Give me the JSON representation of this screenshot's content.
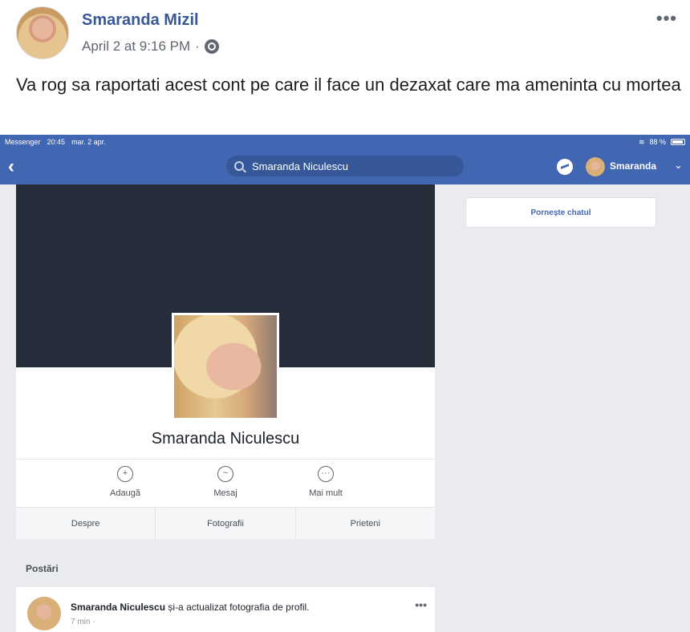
{
  "post": {
    "author": "Smaranda Mizil",
    "timestamp": "April 2 at 9:16 PM",
    "separator": "·",
    "menu": "•••",
    "text": "Va rog sa raportati acest cont pe care il face un dezaxat care ma ameninta cu mortea"
  },
  "screenshot": {
    "status": {
      "app": "Messenger",
      "time": "20:45",
      "date": "mar. 2 apr.",
      "battery": "88 %"
    },
    "navbar": {
      "back": "‹",
      "search_value": "Smaranda Niculescu",
      "user_name": "Smaranda",
      "chevron": "⌄",
      "brand_color": "#4267b2"
    },
    "sidebar": {
      "start_chat": "Pornește chatul"
    },
    "profile": {
      "name": "Smaranda Niculescu",
      "actions": [
        {
          "label": "Adaugă",
          "icon": "+"
        },
        {
          "label": "Mesaj",
          "icon": "~"
        },
        {
          "label": "Mai mult",
          "icon": "···"
        }
      ],
      "tabs": [
        "Despre",
        "Fotografii",
        "Prieteni"
      ]
    },
    "posts": {
      "heading": "Postări",
      "items": [
        {
          "author": "Smaranda Niculescu",
          "action": " și-a actualizat fotografia de profil.",
          "time": "7 min ·",
          "menu": "•••"
        }
      ]
    }
  }
}
